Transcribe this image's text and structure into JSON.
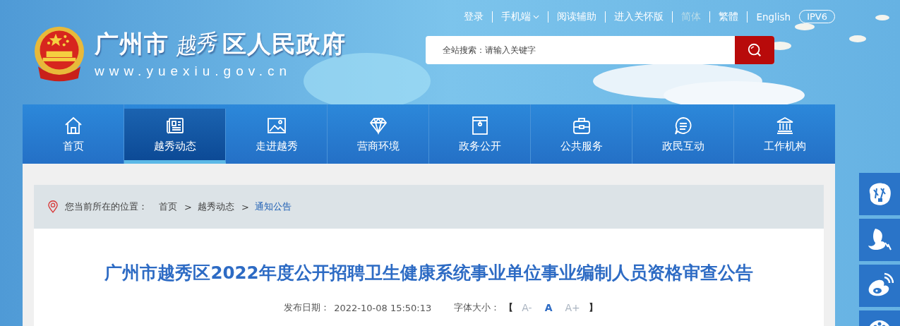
{
  "header": {
    "site_name_a": "广州市",
    "site_name_script": "越秀",
    "site_name_b": "区人民政府",
    "url": "www.yuexiu.gov.cn"
  },
  "top_links": [
    {
      "label": "登录",
      "kind": "link"
    },
    {
      "label": "手机端",
      "kind": "dropdown"
    },
    {
      "label": "阅读辅助",
      "kind": "link"
    },
    {
      "label": "进入关怀版",
      "kind": "link"
    }
  ],
  "languages": [
    {
      "label": "简体",
      "selected": true
    },
    {
      "label": "繁體",
      "selected": false
    },
    {
      "label": "English",
      "selected": false
    }
  ],
  "ipv6_badge": "IPV6",
  "search": {
    "label": "全站搜索：",
    "placeholder": "请输入关键字"
  },
  "nav": [
    {
      "label": "首页",
      "selected": false
    },
    {
      "label": "越秀动态",
      "selected": true
    },
    {
      "label": "走进越秀",
      "selected": false
    },
    {
      "label": "营商环境",
      "selected": false
    },
    {
      "label": "政务公开",
      "selected": false
    },
    {
      "label": "公共服务",
      "selected": false
    },
    {
      "label": "政民互动",
      "selected": false
    },
    {
      "label": "工作机构",
      "selected": false
    }
  ],
  "breadcrumb": {
    "label": "您当前所在的位置：",
    "separator": ">",
    "items": [
      {
        "label": "首页",
        "current": false
      },
      {
        "label": "越秀动态",
        "current": false
      },
      {
        "label": "通知公告",
        "current": true
      }
    ]
  },
  "article": {
    "title": "广州市越秀区2022年度公开招聘卫生健康系统事业单位事业编制人员资格审查公告",
    "date_label": "发布日期：",
    "date": "2022-10-08 15:50:13",
    "font_size_label": "字体大小：",
    "open_bracket": "【",
    "close_bracket": "】",
    "font_sizes": [
      {
        "label": "A-",
        "selected": false
      },
      {
        "label": "A",
        "selected": true
      },
      {
        "label": "A+",
        "selected": false
      }
    ]
  }
}
